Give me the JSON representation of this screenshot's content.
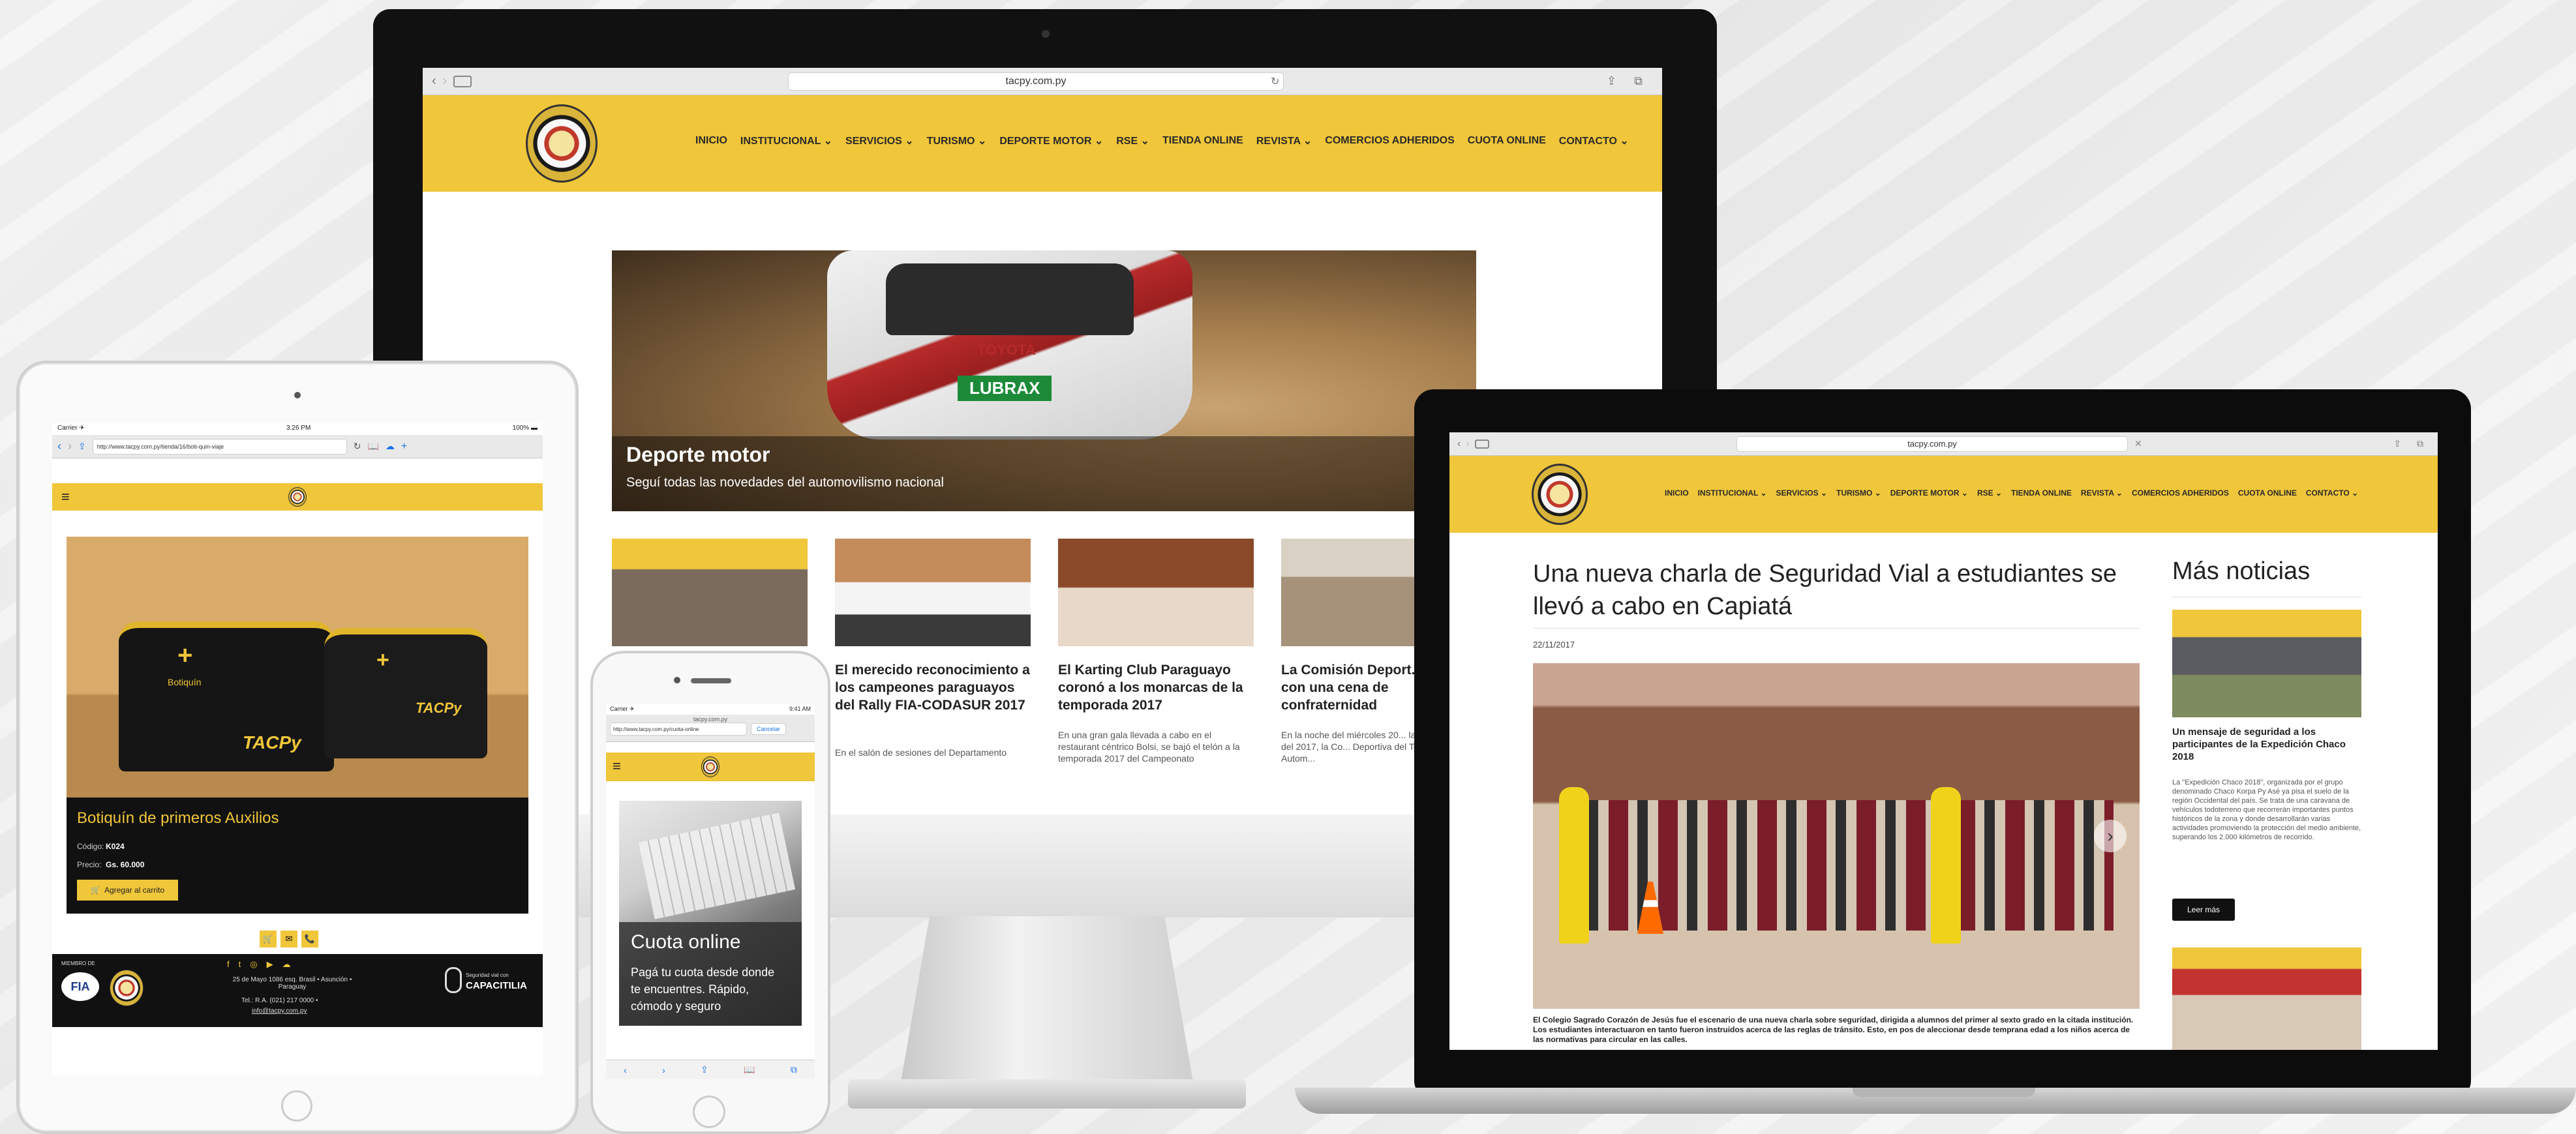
{
  "imac": {
    "url": "tacpy.com.py",
    "nav": [
      "INICIO",
      "INSTITUCIONAL ⌄",
      "SERVICIOS ⌄",
      "TURISMO ⌄",
      "DEPORTE MOTOR ⌄",
      "RSE ⌄",
      "TIENDA ONLINE",
      "REVISTA ⌄",
      "COMERCIOS ADHERIDOS",
      "CUOTA ONLINE",
      "CONTACTO ⌄"
    ],
    "hero_title": "Deporte motor",
    "hero_subtitle": "Seguí todas las novedades del automovilismo nacional",
    "hero_car_text": "LUBRAX",
    "hero_car_text2": "TOYOTA",
    "cards": [
      {
        "title": "El merecido reconocimiento a los campeones paraguayos del Rally FIA-CODASUR 2017",
        "text": "En el salón de sesiones del Departamento"
      },
      {
        "title": "El Karting Club Paraguayo coronó a los monarcas de la temporada 2017",
        "text": "En una gran gala llevada a cabo en el restaurant céntrico Bolsi, se bajó el telón a la temporada 2017 del Campeonato"
      },
      {
        "title": "La Comisión Deport... el 2017 con una cena de confraternidad",
        "text": "En la noche del miércoles 20... las actividades del 2017, la Co... Deportiva del Touring y Autom..."
      }
    ]
  },
  "laptop": {
    "url": "tacpy.com.py",
    "nav": [
      "INICIO",
      "INSTITUCIONAL ⌄",
      "SERVICIOS ⌄",
      "TURISMO ⌄",
      "DEPORTE MOTOR ⌄",
      "RSE ⌄",
      "TIENDA ONLINE",
      "REVISTA ⌄",
      "COMERCIOS ADHERIDOS",
      "CUOTA ONLINE",
      "CONTACTO ⌄"
    ],
    "article_title": "Una nueva charla de Seguridad Vial a estudiantes se llevó a cabo en Capiatá",
    "article_date": "22/11/2017",
    "article_body": "El Colegio Sagrado Corazón de Jesús fue el escenario de una nueva charla sobre seguridad, dirigida a alumnos del primer al sexto grado en la citada institución. Los estudiantes interactuaron en tanto fueron instruidos acerca de las reglas de tránsito. Esto, en pos de aleccionar desde temprana edad a los niños acerca de las normativas para circular en las calles.",
    "sidebar_heading": "Más noticias",
    "side_title": "Un mensaje de seguridad a los participantes de la Expedición Chaco 2018",
    "side_text": "La \"Expedición Chaco 2018\", organizada por el grupo denominado Chaco Korpa Py Asé ya pisa el suelo de la región Occidental del país. Se trata de una caravana de vehículos todoterreno que recorrerán importantes puntos históricos de la zona y donde desarrollarán varias actividades promoviendo la protección del medio ambiente, superando los 2.000 kilómetros de recorrido.",
    "side_button": "Leer más"
  },
  "tablet": {
    "status_left": "Carrier ✈",
    "status_time": "3:26 PM",
    "status_right": "100% ▬",
    "url": "http://www.tacpy.com.py/tienda/16/boti-quin-viaje",
    "product_title": "Botiquín de primeros Auxilios",
    "code_label": "Código:",
    "code_value": "K024",
    "price_label": "Precio:",
    "price_value": "Gs. 60.000",
    "add_button": "Agregar al carrito",
    "bag_brand": "TACPy",
    "bag_label": "Botiquín",
    "footer_member": "MIEMBRO DE",
    "footer_fia": "FIA",
    "footer_address": "25 de Mayo 1086 esq. Brasil • Asunción • Paraguay",
    "footer_tel": "Tel.: R.A. (021) 217 0000 •",
    "footer_email": "info@tacpy.com.py",
    "footer_brand_small": "Seguridad vial con",
    "footer_brand": "CAPACITILIA",
    "social_icons": [
      "f",
      "t",
      "◎",
      "▶",
      "☁"
    ],
    "shop_icons": [
      "🛒",
      "✉",
      "📞"
    ]
  },
  "phone": {
    "status_left": "Carrier ✈",
    "status_time": "9:41 AM",
    "url_top": "tacpy.com.py",
    "url": "http://www.tacpy.com.py/cuota-online",
    "cancel": "Cancelar",
    "banner_title": "Cuota online",
    "banner_text": "Pagá tu cuota desde donde te encuentres. Rápido, cómodo y seguro"
  }
}
